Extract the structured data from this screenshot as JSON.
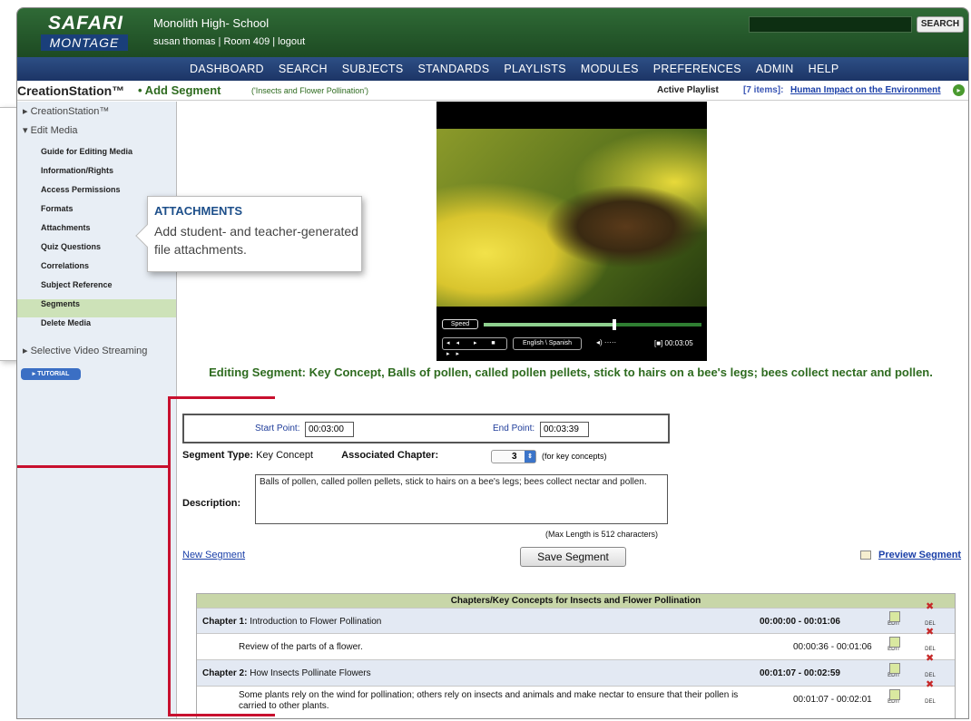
{
  "header": {
    "logo_top": "SAFARI",
    "logo_bottom": "MONTAGE",
    "school": "Monolith High- School",
    "user_line": "susan thomas | Room 409 | logout",
    "search_label": "SEARCH"
  },
  "nav": [
    "DASHBOARD",
    "SEARCH",
    "SUBJECTS",
    "STANDARDS",
    "PLAYLISTS",
    "MODULES",
    "PREFERENCES",
    "ADMIN",
    "HELP"
  ],
  "breadcrumb": {
    "app": "CreationStation™",
    "page": "• Add Segment",
    "video": "('Insects and Flower Pollination')",
    "playlist_label": "Active Playlist",
    "playlist_count": "[7 items]:",
    "playlist_name": "Human Impact on the Environment"
  },
  "sidebar": {
    "creation": "CreationStation™",
    "edit_media": "Edit Media",
    "subs": [
      "Guide for Editing Media",
      "Information/Rights",
      "Access Permissions",
      "Formats",
      "Attachments",
      "Quiz Questions",
      "Correlations",
      "Subject Reference",
      "Segments",
      "Delete Media"
    ],
    "selective": "Selective Video Streaming",
    "tutorial": "TUTORIAL"
  },
  "video": {
    "speed": "Speed",
    "language": "English \\ Spanish",
    "time": "00:03:05",
    "controls": "◂◂ ▸ ■ ▸▸",
    "volume": "◂) ·····",
    "fullscreen": "[■]",
    "progress": 0.6
  },
  "editing_title": "Editing Segment: Key Concept, Balls of pollen, called pollen pellets, stick to hairs on a bee's legs; bees collect nectar and pollen.",
  "form": {
    "start_label": "Start Point:",
    "start_value": "00:03:00",
    "end_label": "End Point:",
    "end_value": "00:03:39",
    "segment_type_label": "Segment Type:",
    "segment_type_value": "Key Concept",
    "chapter_label": "Associated Chapter:",
    "chapter_value": "3",
    "chapter_note": "(for key concepts)",
    "description_label": "Description:",
    "description_value": "Balls of pollen, called pollen pellets, stick to hairs on a bee's legs; bees collect nectar and pollen.",
    "max_length": "(Max Length is 512 characters)",
    "new_segment": "New Segment",
    "save_segment": "Save Segment",
    "preview_segment": "Preview Segment"
  },
  "table": {
    "title": "Chapters/Key Concepts for Insects and Flower Pollination",
    "edit": "EDIT",
    "del": "DEL",
    "rows": [
      {
        "label_bold": "Chapter 1:",
        "label": "Introduction to Flower Pollination",
        "time": "00:00:00 - 00:01:06",
        "chapter": true
      },
      {
        "label_bold": "",
        "label": "Review of the parts of a flower.",
        "time": "00:00:36 - 00:01:06",
        "chapter": false
      },
      {
        "label_bold": "Chapter 2:",
        "label": "How Insects Pollinate Flowers",
        "time": "00:01:07 - 00:02:59",
        "chapter": true
      },
      {
        "label_bold": "",
        "label": "Some plants rely on the wind for pollination; others rely on insects and animals and make nectar to ensure that their pollen is carried to other plants.",
        "time": "00:01:07 - 00:02:01",
        "chapter": false
      }
    ]
  },
  "callout": {
    "heading": "ATTACHMENTS",
    "body": "Add student- and teacher-generated file attachments."
  },
  "colors": {
    "header_green": "#2f6a36",
    "nav_blue": "#1c3566",
    "accent_red": "#c8102e",
    "title_green": "#2e6b1f"
  }
}
